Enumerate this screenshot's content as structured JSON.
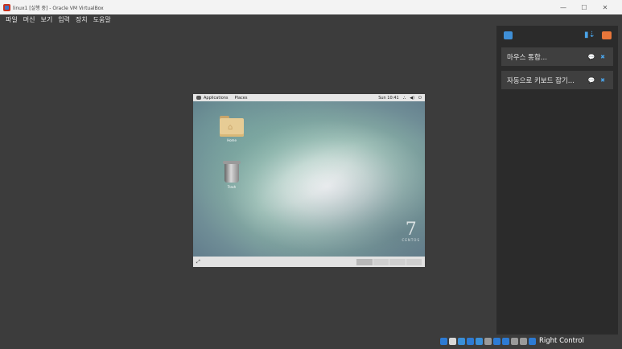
{
  "window": {
    "title": "linux1 [실행 중] - Oracle VM VirtualBox",
    "minimize": "—",
    "maximize": "☐",
    "close": "✕"
  },
  "menu": [
    "파일",
    "머신",
    "보기",
    "입력",
    "장치",
    "도움말"
  ],
  "guest": {
    "topbar": {
      "applications": "Applications",
      "places": "Places",
      "time": "Sun 10:41",
      "network_icon": "⛬",
      "volume_icon": "◀)",
      "power_icon": "⏻"
    },
    "desktop_icons": [
      {
        "label": "Home"
      },
      {
        "label": "Trash"
      }
    ],
    "watermark": {
      "numeral": "7",
      "word": "CENTOS"
    },
    "bottombar": {
      "corner_icon": "⤢"
    }
  },
  "notifications": {
    "cards": [
      {
        "text": "마우스 통합...",
        "action_icon": "💬",
        "close_icon": "✖"
      },
      {
        "text": "자동으로 키보드 잡기...",
        "action_icon": "💬",
        "close_icon": "✖"
      }
    ]
  },
  "statusbar": {
    "host_key": "Right Control",
    "icons": [
      "hard-disk-icon",
      "optical-drive-icon",
      "audio-icon",
      "network-icon",
      "usb-icon",
      "shared-folders-icon",
      "display-icon",
      "recording-icon",
      "cpu-icon",
      "mouse-icon",
      "keyboard-icon"
    ],
    "icon_colors": [
      "#2d7bd4",
      "#d8d8d8",
      "#3a8fd8",
      "#2d7bd4",
      "#3a8fd8",
      "#9a9a9a",
      "#2d7bd4",
      "#2d7bd4",
      "#9a9a9a",
      "#9a9a9a",
      "#2d7bd4"
    ]
  }
}
